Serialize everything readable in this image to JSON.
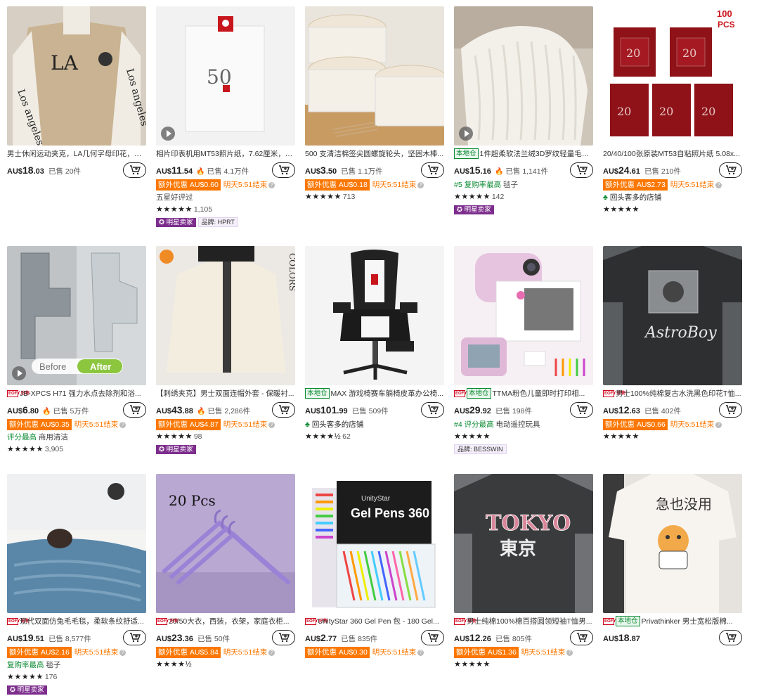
{
  "ui": {
    "currency": "AU$",
    "promo_label": "额外优惠",
    "deadline": "明天5:51结束",
    "star_seller": "明星卖家",
    "brand_prefix": "品牌:"
  },
  "products": [
    {
      "title": "男士休闲运动夹克，LA几何字母印花，纽...",
      "price": "18",
      "cents": ".03",
      "sold": "已售 20件"
    },
    {
      "title": "相片印表机用MT53照片纸，7.62厘米，可...",
      "price": "11",
      "cents": ".54",
      "sold": "已售 4.1万件",
      "promo": "AU$0.60",
      "extra": "五星好评过",
      "stars": "★★★★★",
      "reviews": "1,105",
      "star_seller": true,
      "brand": "HPRT"
    },
    {
      "title": "500 支清洁棉签尖圆螺旋轮头，坚固木棒...",
      "price": "3",
      "cents": ".50",
      "sold": "已售 1.1万件",
      "promo": "AU$0.18",
      "stars": "★★★★★",
      "reviews": "713"
    },
    {
      "title": "1件超柔软法兰绒3D罗纹轻量毛毯...",
      "tag": "本地仓",
      "price": "15",
      "cents": ".16",
      "sold": "已售 1,141件",
      "rank": "#5 复购率最高",
      "rank_cat": "毯子",
      "stars": "★★★★★",
      "reviews": "142",
      "star_seller": true
    },
    {
      "title": "20/40/100张原装MT53自粘照片纸 5.08x...",
      "price": "24",
      "cents": ".61",
      "sold": "已售 210件",
      "promo": "AU$2.73",
      "store": "回头客多的店铺",
      "stars": "★★★★★"
    },
    {
      "title": "JB-XPCS H71 强力水点去除剂和浴...",
      "eofy": true,
      "price": "6",
      "cents": ".80",
      "sold": "已售 5万件",
      "rank": "评分最高",
      "rank_cat": "商用清洁",
      "stars": "★★★★★",
      "reviews": "3,905"
    },
    {
      "title": "【刺绣夹克】男士双面连帽外套 - 保暖衬...",
      "price": "43",
      "cents": ".88",
      "sold": "已售 2,286件",
      "promo": "AU$4.87",
      "stars": "★★★★★",
      "reviews": "98",
      "star_seller": true
    },
    {
      "title": "MAX 游戏椅赛车躺椅皮革办公椅...",
      "tag": "本地仓",
      "price": "101",
      "cents": ".99",
      "sold": "已售 509件",
      "store": "回头客多的店铺",
      "stars": "★★★★½",
      "reviews": "62"
    },
    {
      "title": "TTMA粉色儿童即时打印相...",
      "eofy": true,
      "tag": "本地仓",
      "price": "29",
      "cents": ".92",
      "sold": "已售 198件",
      "rank": "#4 评分最高",
      "rank_cat": "电动遥控玩具",
      "stars": "★★★★★",
      "brand": "BESSWIN"
    },
    {
      "title": "男士100%纯棉复古水洗黑色印花T恤...",
      "eofy": true,
      "price": "12",
      "cents": ".63",
      "sold": "已售 402件",
      "promo": "AU$0.66",
      "stars": "★★★★★"
    },
    {
      "title": "现代双面仿兔毛毛毯，柔软条纹舒适...",
      "eofy": true,
      "price": "19",
      "cents": ".51",
      "sold": "已售 8,577件",
      "promo": "AU$2.16",
      "rank": "复购率最高",
      "rank_cat": "毯子",
      "stars": "★★★★★",
      "reviews": "176",
      "star_seller": true
    },
    {
      "title": "20/50大衣，西装，衣架，家庭衣柜...",
      "eofy": true,
      "price": "23",
      "cents": ".36",
      "sold": "已售 50件",
      "promo": "AU$5.84",
      "stars": "★★★★½"
    },
    {
      "title": "UnityStar 360 Gel Pen 包 - 180 Gel...",
      "eofy": true,
      "price": "2",
      "cents": ".77",
      "sold": "已售 835件",
      "promo": "AU$0.30"
    },
    {
      "title": "男士纯棉100%棉百搭圆领短袖T恤男...",
      "eofy": true,
      "price": "12",
      "cents": ".26",
      "sold": "已售 805件",
      "promo": "AU$1.36",
      "stars": "★★★★★"
    },
    {
      "title": "Privathinker 男士宽松版棉...",
      "eofy": true,
      "tag": "本地仓",
      "price": "18",
      "cents": ".87"
    }
  ],
  "image_text": {
    "p2_num": "50",
    "p5_badge": "100 PCS",
    "p5_num": "20",
    "p6_before": "Before",
    "p6_after": "After",
    "p7_colors": "COLORS",
    "p12_label": "20 Pcs",
    "p13_brand": "UnityStar",
    "p13_title": "Gel Pens 360",
    "p14_text": "TOKYO",
    "p14_kanji": "東京",
    "p15_kanji": "急也没用"
  },
  "icons": {
    "cart": "add-to-cart-icon",
    "play": "play-icon",
    "flame": "flame-icon",
    "info": "question-icon"
  },
  "colors": {
    "promo": "#fb7701",
    "local_tag": "#0a8a32",
    "star_seller": "#7d2e8d",
    "eofy": "#d0021b"
  }
}
